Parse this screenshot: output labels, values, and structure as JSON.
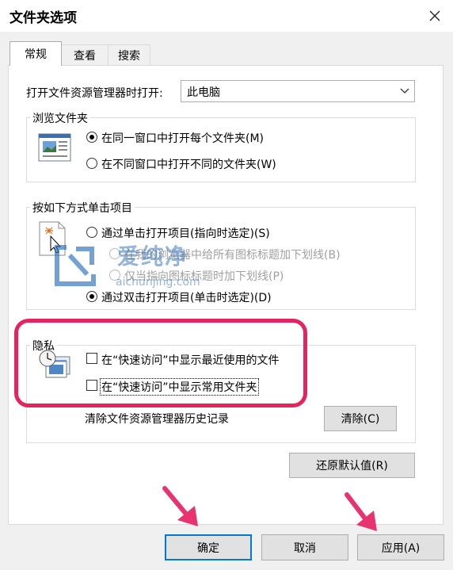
{
  "window": {
    "title": "文件夹选项",
    "close_icon": "close-icon"
  },
  "tabs": [
    {
      "label": "常规",
      "active": true
    },
    {
      "label": "查看",
      "active": false
    },
    {
      "label": "搜索",
      "active": false
    }
  ],
  "open_explorer": {
    "label": "打开文件资源管理器时打开:",
    "value": "此电脑"
  },
  "browse_folders": {
    "title": "浏览文件夹",
    "options": [
      {
        "label": "在同一窗口中打开每个文件夹(M)",
        "checked": true
      },
      {
        "label": "在不同窗口中打开不同的文件夹(W)",
        "checked": false
      }
    ]
  },
  "click_items": {
    "title": "按如下方式单击项目",
    "single_click": "通过单击打开项目(指向时选定)(S)",
    "underline_browser": "在我的浏览器中给所有图标标题加下划线(B)",
    "underline_point": "仅当指向图标标题时加下划线(P)",
    "double_click": "通过双击打开项目(单击时选定)(D)",
    "selected": "double_click"
  },
  "privacy": {
    "title": "隐私",
    "recent_files": "在“快速访问”中显示最近使用的文件",
    "frequent_folders": "在“快速访问”中显示常用文件夹",
    "clear_history_label": "清除文件资源管理器历史记录",
    "clear_button": "清除(C)",
    "recent_checked": false,
    "frequent_checked": false
  },
  "restore_defaults_button": "还原默认值(R)",
  "footer": {
    "ok": "确定",
    "cancel": "取消",
    "apply": "应用(A)"
  },
  "watermark": {
    "cn": "爱纯净",
    "url": "aichunjing.com"
  },
  "colors": {
    "highlight": "#e5245f",
    "arrow": "#e8336f",
    "default_button_border": "#0078d7"
  }
}
